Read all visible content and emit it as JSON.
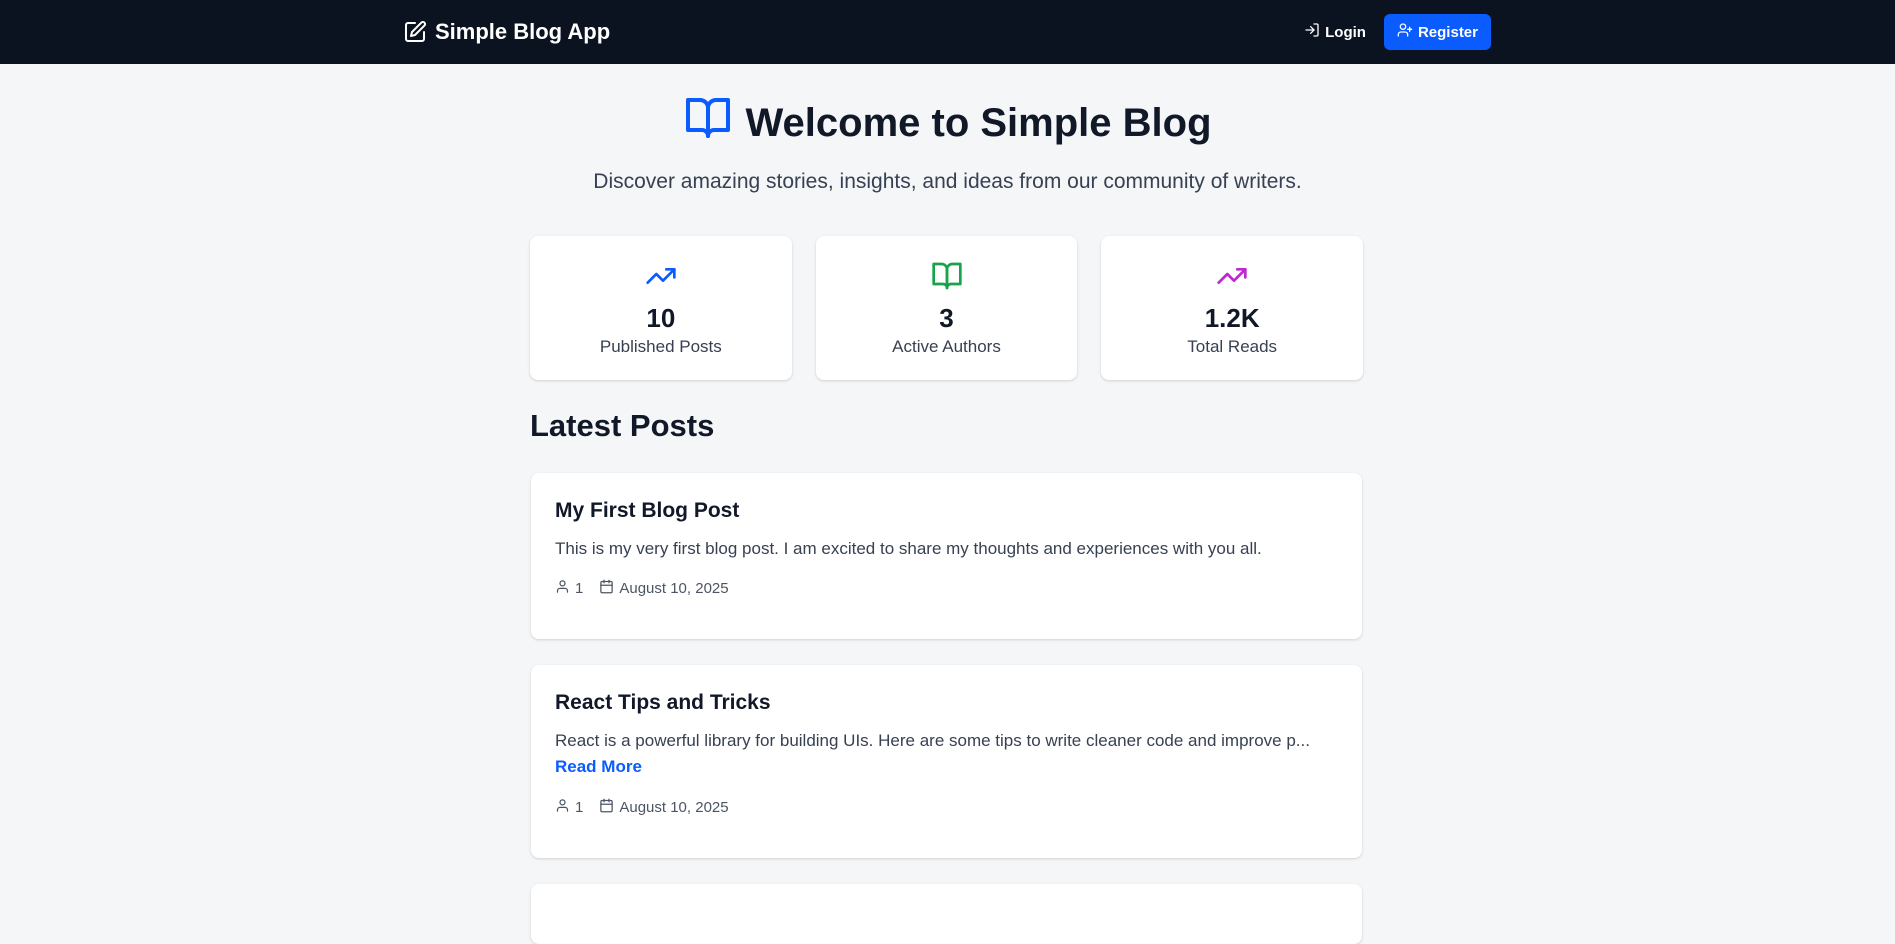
{
  "navbar": {
    "brand": "Simple Blog App",
    "brand_icon": "edit-square-icon",
    "login_label": "Login",
    "register_label": "Register",
    "register_color": "#0a5cff"
  },
  "hero": {
    "title": "Welcome to Simple Blog",
    "subtitle": "Discover amazing stories, insights, and ideas from our community of writers.",
    "icon": "book-open-icon"
  },
  "stats": [
    {
      "value": "10",
      "label": "Published Posts",
      "icon": "trending-up-icon",
      "color": "#0a5cff"
    },
    {
      "value": "3",
      "label": "Active Authors",
      "icon": "book-open-icon",
      "color": "#16a34a"
    },
    {
      "value": "1.2K",
      "label": "Total Reads",
      "icon": "trending-up-icon",
      "color": "#c026d3"
    }
  ],
  "section": {
    "title": "Latest Posts"
  },
  "posts": [
    {
      "title": "My First Blog Post",
      "excerpt": "This is my very first blog post. I am excited to share my thoughts and experiences with you all.",
      "read_more": "",
      "author": "1",
      "date": "August 10, 2025"
    },
    {
      "title": "React Tips and Tricks",
      "excerpt": "React is a powerful library for building UIs. Here are some tips to write cleaner code and improve p...",
      "read_more": "Read More",
      "author": "1",
      "date": "August 10, 2025"
    }
  ]
}
